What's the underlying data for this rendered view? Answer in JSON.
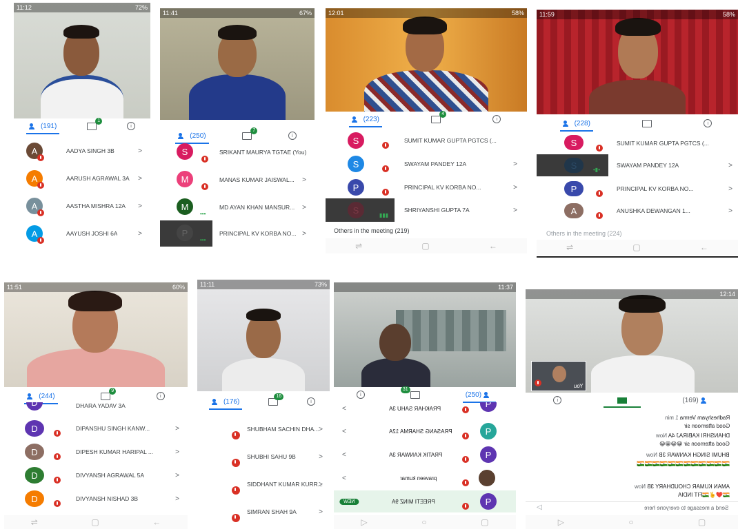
{
  "colors": {
    "accent": "#1a73e8",
    "mute": "#d93025",
    "speaking": "#34a853",
    "badge": "#1e8e3e"
  },
  "icons": {
    "people": "people-icon",
    "chat": "chat-icon",
    "info": "info-icon",
    "mic_off": "mic-off-icon",
    "nav_back": "back-icon",
    "nav_home": "home-icon",
    "nav_recent": "recent-icon"
  },
  "shots": [
    {
      "status": {
        "time": "11:12",
        "battery": "72%"
      },
      "tabs": {
        "people": "(191)",
        "chat_badge": "1"
      },
      "rows": [
        {
          "initial": "A",
          "name": "AADYA SINGH 3B"
        },
        {
          "initial": "A",
          "name": "AARUSH AGRAWAL 3A"
        },
        {
          "initial": "A",
          "name": "AASTHA MISHRA 12A"
        },
        {
          "initial": "A",
          "name": "AAYUSH JOSHI 6A"
        }
      ]
    },
    {
      "status": {
        "time": "11:41",
        "battery": "67%"
      },
      "tabs": {
        "people": "(250)",
        "chat_badge": "7"
      },
      "rows": [
        {
          "initial": "S",
          "name": "SRIKANT MAURYA TGTAE (You)"
        },
        {
          "initial": "M",
          "name": "MANAS KUMAR JAISWAL..."
        },
        {
          "initial": "M",
          "name": "MD AYAN KHAN MANSUR..."
        },
        {
          "initial": "P",
          "name": "PRINCIPAL KV KORBA NO..."
        }
      ]
    },
    {
      "status": {
        "time": "12:01",
        "battery": "58%"
      },
      "tabs": {
        "people": "(223)",
        "chat_badge": "4"
      },
      "rows": [
        {
          "initial": "S",
          "name": "SUMIT KUMAR GUPTA PGTCS (..."
        },
        {
          "initial": "S",
          "name": "SWAYAM PANDEY 12A"
        },
        {
          "initial": "P",
          "name": "PRINCIPAL KV KORBA NO..."
        },
        {
          "initial": "S",
          "name": "SHRIYANSHI GUPTA 7A"
        }
      ],
      "others": "Others in the meeting (219)"
    },
    {
      "status": {
        "time": "11:59",
        "battery": "58%"
      },
      "tabs": {
        "people": "(228)",
        "chat_badge": ""
      },
      "rows": [
        {
          "initial": "S",
          "name": "SUMIT KUMAR GUPTA PGTCS (..."
        },
        {
          "initial": "S",
          "name": "SWAYAM PANDEY 12A"
        },
        {
          "initial": "P",
          "name": "PRINCIPAL KV KORBA NO..."
        },
        {
          "initial": "A",
          "name": "ANUSHKA DEWANGAN 1..."
        }
      ],
      "others": "Others in the meeting (224)"
    },
    {
      "status": {
        "time": "11:51",
        "battery": "60%"
      },
      "tabs": {
        "people": "(244)",
        "chat_badge": "9"
      },
      "rows": [
        {
          "initial": "D",
          "name": "DHARA YADAV 3A"
        },
        {
          "initial": "D",
          "name": "DIPANSHU SINGH KANW..."
        },
        {
          "initial": "D",
          "name": "DIPESH KUMAR HARIPAL ..."
        },
        {
          "initial": "D",
          "name": "DIVYANSH AGRAWAL 5A"
        },
        {
          "initial": "D",
          "name": "DIVYANSH NISHAD 3B"
        }
      ]
    },
    {
      "status": {
        "time": "11:11",
        "battery": "73%"
      },
      "tabs": {
        "people": "(176)",
        "chat_badge": "16"
      },
      "rows": [
        {
          "name": "SHUBHAM SACHIN DHA..."
        },
        {
          "name": "SHUBHI SAHU 9B"
        },
        {
          "name": "SIDDHANT KUMAR KURR..."
        },
        {
          "name": "SIMRAN SHAH 9A"
        }
      ]
    },
    {
      "status": {
        "time": "11:37",
        "battery": ""
      },
      "tabs": {
        "people": "(250)",
        "chat_badge": "31"
      },
      "rows": [
        {
          "initial": "P",
          "name": "PRAKHAR SAHU 3A"
        },
        {
          "initial": "P",
          "name": "PRASANG SHARMA 12A"
        },
        {
          "initial": "P",
          "name": "PRATIK KANWAR 3A"
        },
        {
          "initial": "",
          "name": "praveen kumar"
        },
        {
          "initial": "P",
          "name": "PREETI MINZ 9A",
          "tag": "NEW"
        }
      ]
    },
    {
      "status": {
        "time": "12:14",
        "battery": ""
      },
      "tabs": {
        "people": "(169)",
        "chat_badge": ""
      },
      "self_label": "You",
      "messages": [
        {
          "sender": "Radheshyam Verma",
          "time": "1 min",
          "text": "Good afternoon sir"
        },
        {
          "sender": "DHANSHRI KABIRAJ 4A",
          "time": "Now",
          "text": "Good afternoon sir 😀😀😀😀"
        },
        {
          "sender": "BHUMI SINGH KANWAR 3B",
          "time": "Now",
          "text": "🇮🇳🇮🇳🇮🇳🇮🇳🇮🇳🇮🇳🇮🇳🇮🇳🇮🇳🇮🇳🇮🇳🇮🇳"
        },
        {
          "sender": "AMAN KUMAR CHOUDHARY 3B",
          "time": "Now",
          "text": "🇮🇳❤️✌️🇮🇳FIT INDIA"
        }
      ],
      "compose_placeholder": "Send a message to everyone here"
    }
  ]
}
